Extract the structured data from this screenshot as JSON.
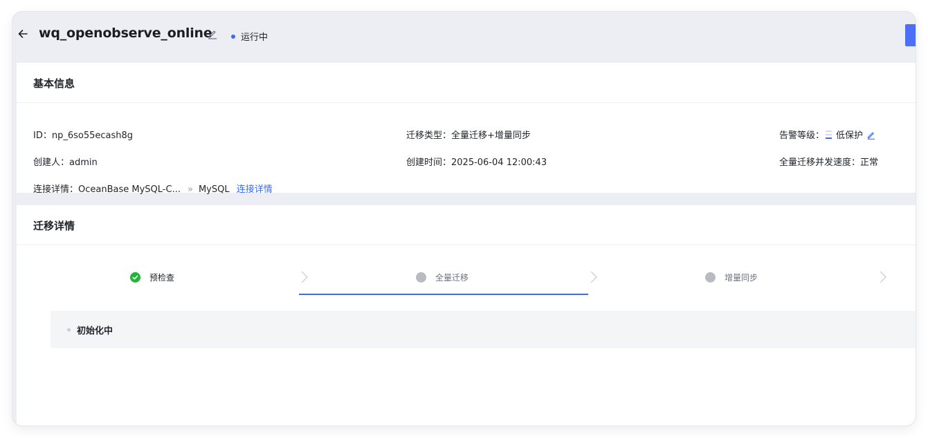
{
  "header": {
    "title": "wq_openobserve_online",
    "status": "运行中",
    "status_color": "#3b6cf0"
  },
  "basic_info": {
    "section_title": "基本信息",
    "id_label": "ID：",
    "id_value": "np_6so55ecash8g",
    "migration_type_label": "迁移类型：",
    "migration_type_value": "全量迁移+增量同步",
    "alert_level_label": "告警等级：",
    "alert_level_value": "低保护",
    "creator_label": "创建人：",
    "creator_value": "admin",
    "created_time_label": "创建时间：",
    "created_time_value": "2025-06-04 12:00:43",
    "concurrency_label": "全量迁移并发速度：",
    "concurrency_value": "正常",
    "connection_label": "连接详情：",
    "connection_source": "OceanBase MySQL-C...",
    "connection_separator": "»",
    "connection_target": "MySQL",
    "connection_link": "连接详情"
  },
  "migration": {
    "section_title": "迁移详情",
    "steps": [
      {
        "label": "预检查",
        "state": "done"
      },
      {
        "label": "全量迁移",
        "state": "active"
      },
      {
        "label": "增量同步",
        "state": "pending"
      }
    ],
    "current_status": "初始化中"
  },
  "icons": {
    "back": "arrow-left-icon",
    "edit": "pencil-icon",
    "check": "check-circle-icon",
    "chevron": "chevron-right-icon",
    "alert_level": "signal-bars-icon"
  },
  "colors": {
    "accent": "#3b6cf0",
    "success": "#23b336",
    "pending": "#b8bbc2",
    "page_bg": "#eceef4"
  }
}
